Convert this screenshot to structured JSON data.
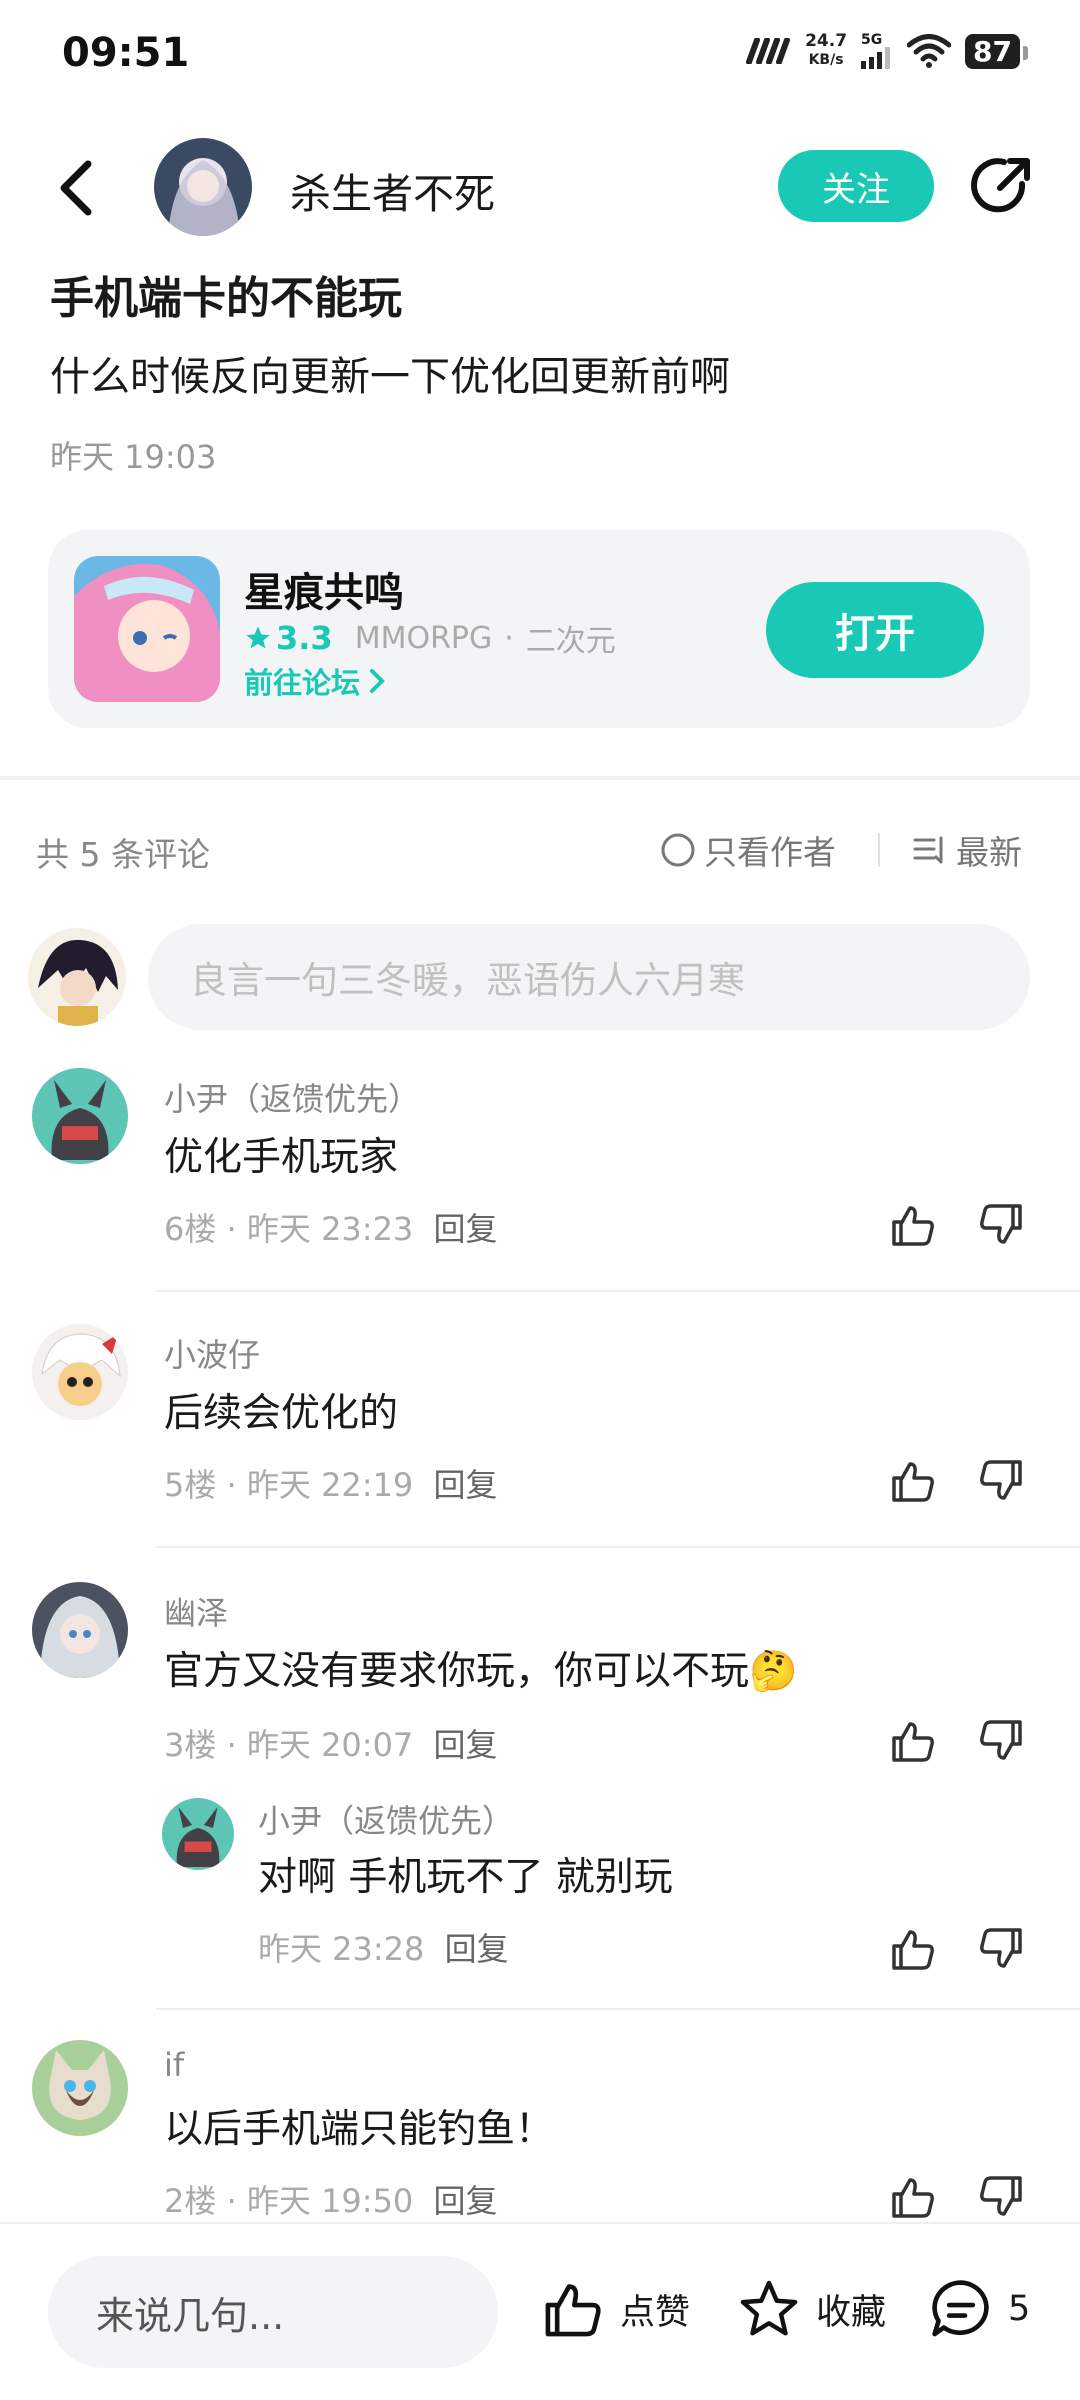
{
  "status_bar": {
    "time": "09:51",
    "net_speed_value": "24.7",
    "net_speed_unit": "KB/s",
    "network_type": "5G",
    "battery": "87"
  },
  "header": {
    "author_name": "杀生者不死",
    "follow_label": "关注"
  },
  "post": {
    "title": "手机端卡的不能玩",
    "body": "什么时候反向更新一下优化回更新前啊",
    "time": "昨天 19:03"
  },
  "game_card": {
    "name": "星痕共鸣",
    "rating": "3.3",
    "genre": "MMORPG",
    "tag": "二次元",
    "separator": "·",
    "forum_link": "前往论坛",
    "open_label": "打开"
  },
  "comments_header": {
    "count_text": "共 5 条评论",
    "author_only_label": "只看作者",
    "sort_label": "最新"
  },
  "compose_placeholder": "良言一句三冬暖，恶语伤人六月寒",
  "comments": [
    {
      "name": "小尹（返馈优先）",
      "text": "优化手机玩家",
      "floor": "6楼",
      "time": "昨天 23:23",
      "reply": "回复"
    },
    {
      "name": "小波仔",
      "text": "后续会优化的",
      "floor": "5楼",
      "time": "昨天 22:19",
      "reply": "回复"
    },
    {
      "name": "幽泽",
      "text": "官方又没有要求你玩，你可以不玩",
      "emoji": "🤔",
      "floor": "3楼",
      "time": "昨天 20:07",
      "reply": "回复",
      "sub_reply": {
        "name": "小尹（返馈优先）",
        "text": "对啊 手机玩不了 就别玩",
        "time": "昨天 23:28",
        "reply": "回复"
      }
    },
    {
      "name": "if",
      "text": "以后手机端只能钓鱼！",
      "floor": "2楼",
      "time": "昨天 19:50",
      "reply": "回复"
    }
  ],
  "meta_separator": "·",
  "bottom_bar": {
    "input_placeholder": "来说几句...",
    "like_label": "点赞",
    "favorite_label": "收藏",
    "comment_count": "5"
  },
  "colors": {
    "accent": "#19c9b5",
    "card_bg": "#f3f4f6",
    "muted_text": "#999999"
  },
  "icons": [
    "back-arrow-icon",
    "share-icon",
    "star-icon",
    "chevron-right-icon",
    "radio-circle-icon",
    "sort-list-icon",
    "thumb-up-icon",
    "thumb-down-icon",
    "star-outline-icon",
    "comment-bubble-icon"
  ]
}
